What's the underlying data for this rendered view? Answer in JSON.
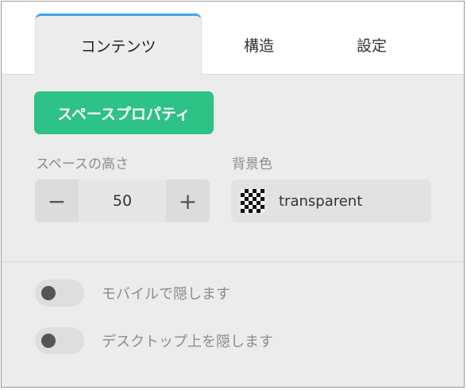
{
  "tabs": [
    {
      "label": "コンテンツ",
      "active": true
    },
    {
      "label": "構造",
      "active": false
    },
    {
      "label": "設定",
      "active": false
    }
  ],
  "section_button": "スペースプロパティ",
  "space_height": {
    "label": "スペースの高さ",
    "value": "50",
    "decrement": "−",
    "increment": "+"
  },
  "background_color": {
    "label": "背景色",
    "value": "transparent"
  },
  "toggles": [
    {
      "label": "モバイルで隠します",
      "on": false
    },
    {
      "label": "デスクトップ上を隠します",
      "on": false
    }
  ],
  "colors": {
    "accent_tab": "#3ea2f0",
    "primary_button": "#2dc286",
    "panel_bg": "#ececec"
  }
}
